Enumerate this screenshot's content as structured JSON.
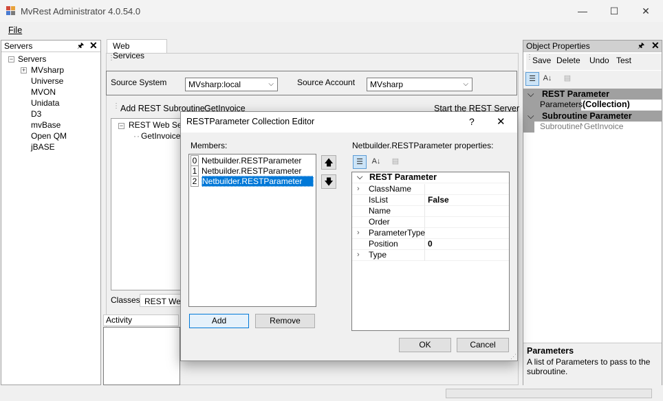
{
  "window": {
    "title": "MvRest Administrator 4.0.54.0",
    "minimize": "—",
    "maximize": "☐",
    "close": "✕"
  },
  "menu": {
    "file": "File"
  },
  "servers_panel": {
    "title": "Servers",
    "pin": "❘",
    "close": "✕",
    "root": "Servers",
    "items": [
      "MVsharp",
      "Universe",
      "MVON",
      "Unidata",
      "D3",
      "mvBase",
      "Open QM",
      "jBASE"
    ]
  },
  "center": {
    "tab": "Web Services",
    "source_system_label": "Source System",
    "source_system_value": "MVsharp:local",
    "source_account_label": "Source Account",
    "source_account_value": "MVsharp",
    "add_rest_label": "Add REST Subroutine",
    "add_rest_value": "GetInvoice",
    "start_server": "Start the REST Server",
    "tree_root": "REST Web Ser",
    "tree_child": "GetInvoice",
    "bottom_tabs": [
      "Classes",
      "REST Web"
    ],
    "activity": "Activity"
  },
  "object_properties": {
    "title": "Object Properties",
    "toolbar": [
      "Save",
      "Delete",
      "Undo",
      "Test"
    ],
    "cat1": "REST Parameter",
    "row1_name": "Parameters",
    "row1_value": "(Collection)",
    "cat2": "Subroutine Parameter",
    "row2_name": "SubroutineN",
    "row2_value": "GetInvoice",
    "help_title": "Parameters",
    "help_text": "A list of Parameters to pass to the subroutine."
  },
  "dialog": {
    "title": "RESTParameter Collection Editor",
    "help": "?",
    "close": "✕",
    "members_label": "Members:",
    "members": [
      {
        "index": "0",
        "label": "Netbuilder.RESTParameter"
      },
      {
        "index": "1",
        "label": "Netbuilder.RESTParameter"
      },
      {
        "index": "2",
        "label": "Netbuilder.RESTParameter"
      }
    ],
    "props_label": "Netbuilder.RESTParameter properties:",
    "category": "REST Parameter",
    "properties": [
      {
        "name": "ClassName",
        "value": ""
      },
      {
        "name": "IsList",
        "value": "False"
      },
      {
        "name": "Name",
        "value": ""
      },
      {
        "name": "Order",
        "value": ""
      },
      {
        "name": "ParameterType",
        "value": ""
      },
      {
        "name": "Position",
        "value": "0"
      },
      {
        "name": "Type",
        "value": ""
      }
    ],
    "add": "Add",
    "remove": "Remove",
    "ok": "OK",
    "cancel": "Cancel"
  },
  "colors": {
    "selection": "#0078d7",
    "category_bg": "#a0a0a0"
  }
}
